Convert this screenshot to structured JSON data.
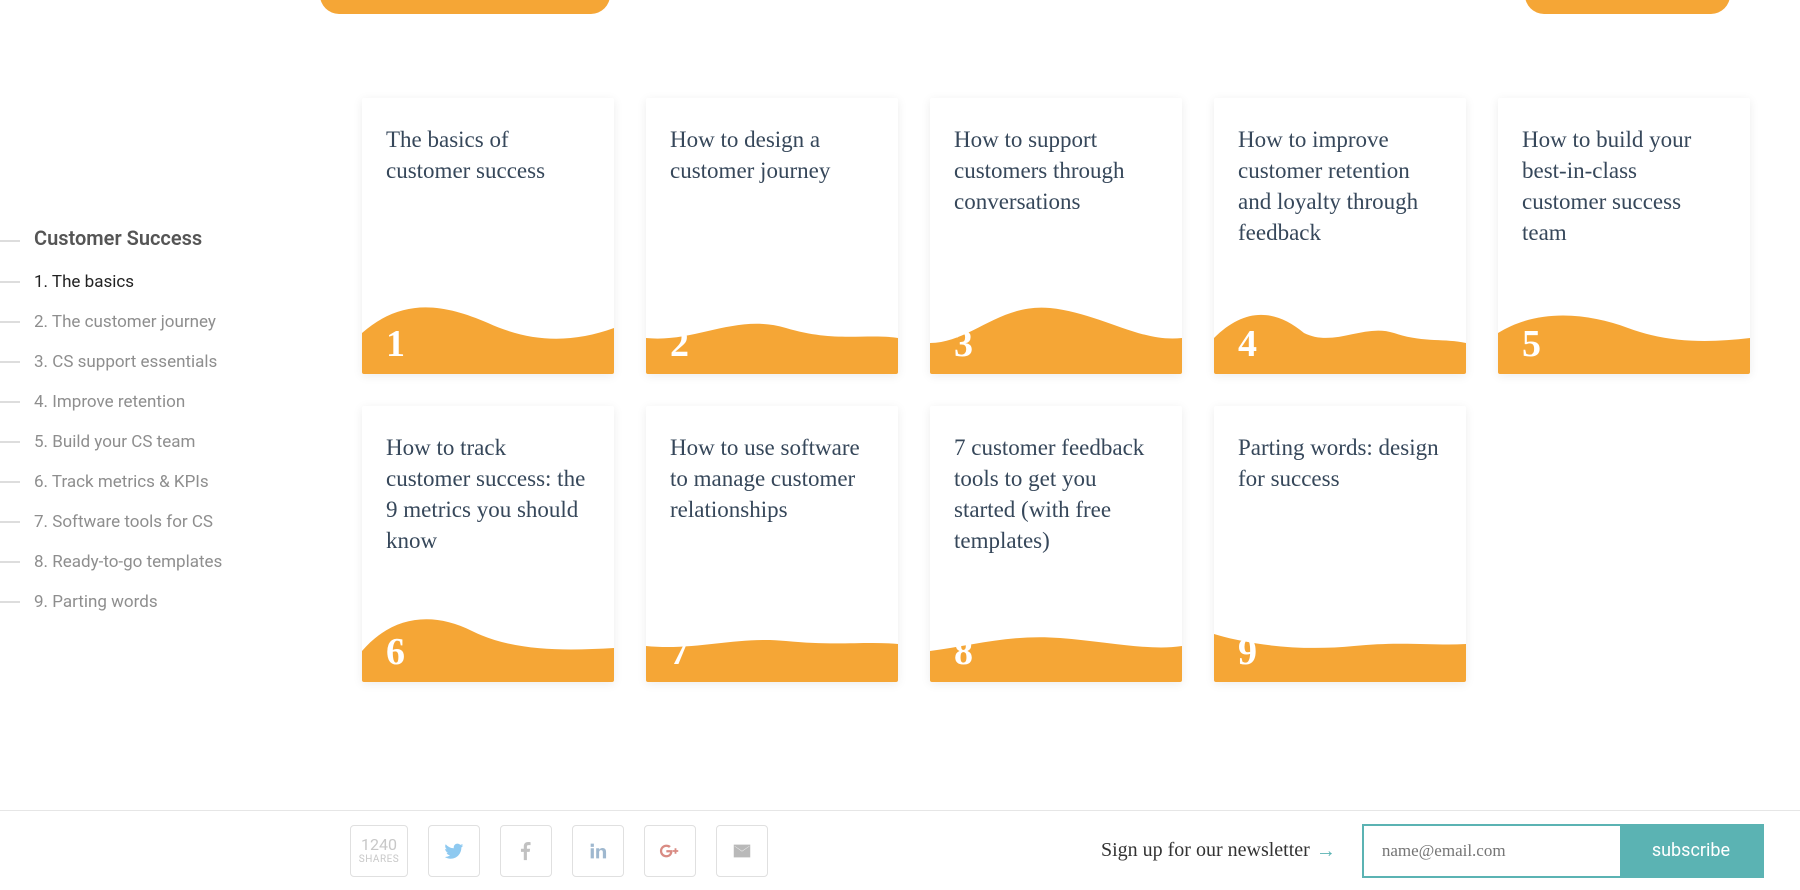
{
  "sidebar": {
    "heading": "Customer Success",
    "items": [
      {
        "label": "1. The basics",
        "active": true
      },
      {
        "label": "2. The customer journey",
        "active": false
      },
      {
        "label": "3. CS support essentials",
        "active": false
      },
      {
        "label": "4. Improve retention",
        "active": false
      },
      {
        "label": "5. Build your CS team",
        "active": false
      },
      {
        "label": "6. Track metrics & KPIs",
        "active": false
      },
      {
        "label": "7. Software tools for CS",
        "active": false
      },
      {
        "label": "8. Ready-to-go templates",
        "active": false
      },
      {
        "label": "9. Parting words",
        "active": false
      }
    ]
  },
  "cards": [
    {
      "num": "1",
      "title": "The basics of customer success"
    },
    {
      "num": "2",
      "title": "How to design a customer journey"
    },
    {
      "num": "3",
      "title": "How to support customers through conversations"
    },
    {
      "num": "4",
      "title": "How to improve customer retention and loyalty through feedback"
    },
    {
      "num": "5",
      "title": "How to build your best-in-class customer success team"
    },
    {
      "num": "6",
      "title": "How to track customer success: the 9 metrics you should know"
    },
    {
      "num": "7",
      "title": "How to use software to manage customer relationships"
    },
    {
      "num": "8",
      "title": "7 customer feedback tools to get you started (with free templates)"
    },
    {
      "num": "9",
      "title": "Parting words: design for success"
    }
  ],
  "footer": {
    "share_count": "1240",
    "share_label": "SHARES",
    "signup_label": "Sign up for our newsletter",
    "email_placeholder": "name@email.com",
    "subscribe_label": "subscribe"
  },
  "colors": {
    "accent": "#f5a636",
    "teal": "#5bb3b3"
  }
}
